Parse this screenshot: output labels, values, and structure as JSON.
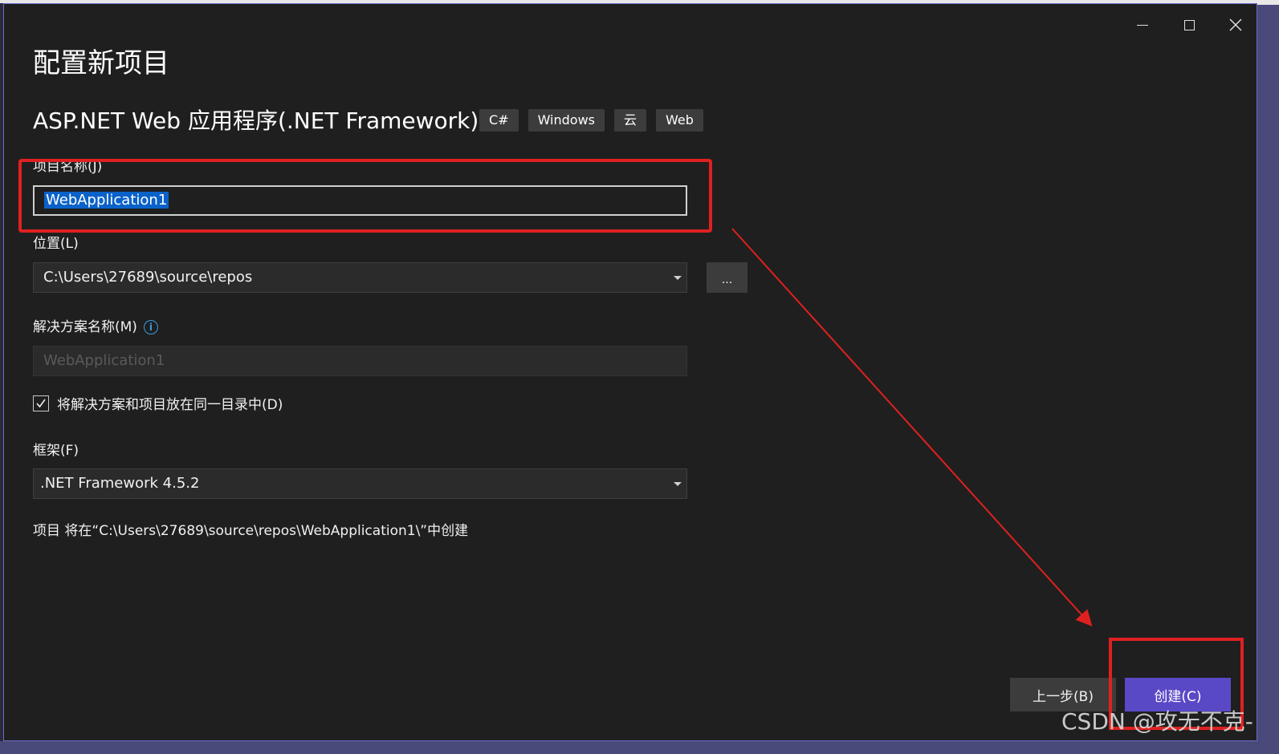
{
  "dialog": {
    "title": "配置新项目",
    "template_name": "ASP.NET Web 应用程序(.NET Framework)",
    "tags": [
      "C#",
      "Windows",
      "云",
      "Web"
    ]
  },
  "project_name": {
    "label": "项目名称(J)",
    "value": "WebApplication1"
  },
  "location": {
    "label": "位置(L)",
    "value": "C:\\Users\\27689\\source\\repos",
    "browse_label": "..."
  },
  "solution_name": {
    "label": "解决方案名称(M)",
    "placeholder": "WebApplication1"
  },
  "same_directory": {
    "label": "将解决方案和项目放在同一目录中(D)",
    "checked": true
  },
  "framework": {
    "label": "框架(F)",
    "value": ".NET Framework 4.5.2"
  },
  "path_note": "项目 将在“C:\\Users\\27689\\source\\repos\\WebApplication1\\”中创建",
  "buttons": {
    "back": "上一步(B)",
    "create": "创建(C)"
  },
  "watermark": "CSDN @攻无不克-",
  "colors": {
    "background": "#1f1f1f",
    "accent": "#5a49c6",
    "selection": "#0a62c9",
    "annotation": "#e02020"
  }
}
